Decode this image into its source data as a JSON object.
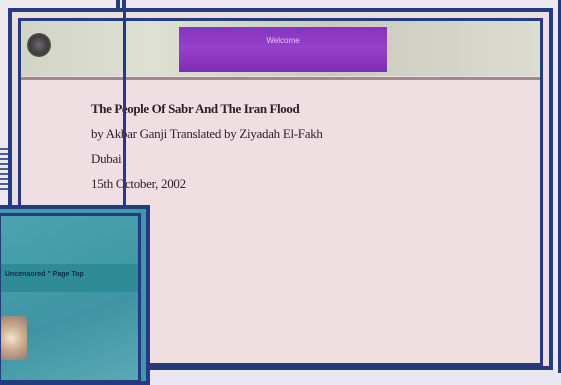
{
  "document": {
    "title": "The People Of Sabr And The Iran Flood",
    "byline": "by Akbar Ganji  Translated by Ziyadah El-Fakh",
    "place": "Dubai",
    "date": "15th October, 2002"
  },
  "banner": {
    "strip_label": "Welcome"
  },
  "teal_window": {
    "heading": "Uncensored \" Page Top"
  }
}
